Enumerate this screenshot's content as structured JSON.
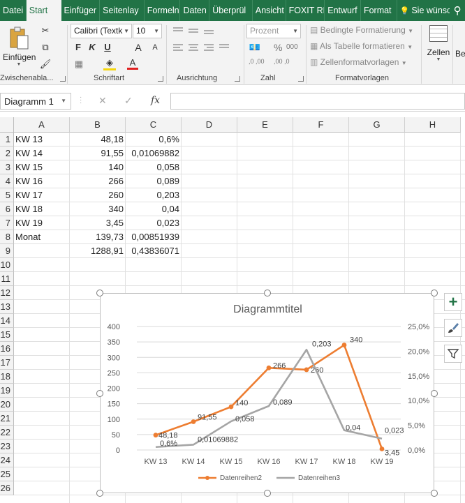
{
  "ribbon_tabs": [
    "Datei",
    "Start",
    "Einfüger",
    "Seitenlay",
    "Formeln",
    "Daten",
    "Überprül",
    "Ansicht",
    "FOXIT RE",
    "Entwurf",
    "Format",
    "Sie wünsc"
  ],
  "ribbon": {
    "clipboard": {
      "paste_label": "Einfügen",
      "group_label": "Zwischenabla..."
    },
    "font": {
      "font_name": "Calibri (Textk",
      "font_size": "10",
      "bold": "F",
      "italic": "K",
      "underline": "U",
      "grow": "A",
      "shrink": "A",
      "font_color": "A",
      "group_label": "Schriftart"
    },
    "alignment": {
      "group_label": "Ausrichtung"
    },
    "number": {
      "format": "Prozent",
      "percent": "%",
      "thousands": "000",
      "inc_decimals": ",0 ,00",
      "dec_decimals": ",00 ,0",
      "group_label": "Zahl"
    },
    "styles": {
      "conditional": "Bedingte Formatierung",
      "as_table": "Als Tabelle formatieren",
      "cell_styles": "Zellenformatvorlagen",
      "group_label": "Formatvorlagen"
    },
    "cells": {
      "label": "Zellen"
    },
    "editing": {
      "label": "Be"
    }
  },
  "formula_bar": {
    "name_box": "Diagramm 1",
    "cancel": "✕",
    "confirm": "✓",
    "fx": "fx",
    "formula": ""
  },
  "columns": [
    "A",
    "B",
    "C",
    "D",
    "E",
    "F",
    "G",
    "H"
  ],
  "rows": [
    "1",
    "2",
    "3",
    "4",
    "5",
    "6",
    "7",
    "8",
    "9",
    "10",
    "11",
    "12",
    "13",
    "14",
    "15",
    "16",
    "17",
    "18",
    "19",
    "20",
    "21",
    "22",
    "23",
    "24",
    "25",
    "26"
  ],
  "cells": [
    [
      "KW 13",
      "48,18",
      "0,6%"
    ],
    [
      "KW 14",
      "91,55",
      "0,01069882"
    ],
    [
      "KW 15",
      "140",
      "0,058"
    ],
    [
      "KW 16",
      "266",
      "0,089"
    ],
    [
      "KW 17",
      "260",
      "0,203"
    ],
    [
      "KW 18",
      "340",
      "0,04"
    ],
    [
      "KW 19",
      "3,45",
      "0,023"
    ],
    [
      "Monat",
      "139,73",
      "0,00851939"
    ],
    [
      "",
      "1288,91",
      "0,43836071"
    ]
  ],
  "colors": {
    "excel_green": "#217346",
    "series_orange": "#ED7D31",
    "series_gray": "#A5A5A5"
  },
  "chart_data": {
    "type": "line",
    "title": "Diagrammtitel",
    "categories": [
      "KW 13",
      "KW 14",
      "KW 15",
      "KW 16",
      "KW 17",
      "KW 18",
      "KW 19"
    ],
    "series": [
      {
        "name": "Datenreihen2",
        "axis": "left",
        "color": "#ED7D31",
        "markers": true,
        "values": [
          48.18,
          91.55,
          140,
          266,
          260,
          340,
          3.45
        ],
        "labels": [
          "48,18",
          "91,55",
          "140",
          "266",
          "260",
          "340",
          "3,45"
        ]
      },
      {
        "name": "Datenreihen3",
        "axis": "right",
        "color": "#A5A5A5",
        "markers": false,
        "values": [
          0.006,
          0.01069882,
          0.058,
          0.089,
          0.203,
          0.04,
          0.023
        ],
        "labels": [
          "0,6%",
          "0,01069882",
          "0,058",
          "0,089",
          "0,203",
          "0,04",
          "0,023"
        ]
      }
    ],
    "y_left": {
      "min": 0,
      "max": 400,
      "ticks": [
        "0",
        "50",
        "100",
        "150",
        "200",
        "250",
        "300",
        "350",
        "400"
      ]
    },
    "y_right": {
      "min": 0,
      "max": 0.25,
      "ticks": [
        "0,0%",
        "5,0%",
        "10,0%",
        "15,0%",
        "20,0%",
        "25,0%"
      ]
    },
    "grid": true,
    "legend": "bottom"
  },
  "side_buttons": [
    "chart-elements",
    "chart-styles",
    "chart-filters"
  ]
}
